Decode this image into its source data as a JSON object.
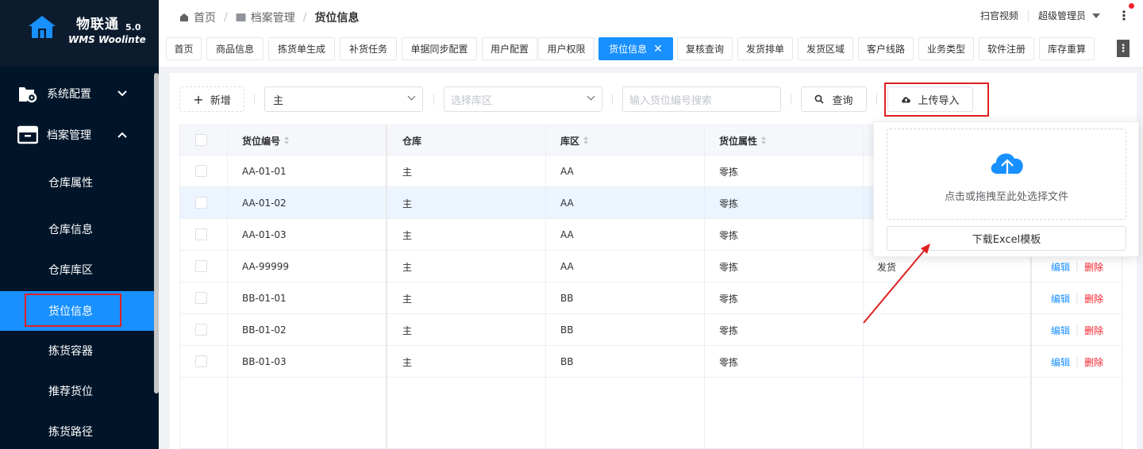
{
  "app": {
    "brand": "物联通",
    "version": "5.0",
    "subtitle": "WMS Woolinte"
  },
  "sidebar": {
    "groups": [
      {
        "label": "系统配置",
        "icon": "folder-gear-icon",
        "expanded": false
      },
      {
        "label": "档案管理",
        "icon": "archive-box-icon",
        "expanded": true
      }
    ],
    "items": [
      {
        "label": "仓库属性",
        "active": false
      },
      {
        "label": "仓库信息",
        "active": false
      },
      {
        "label": "仓库库区",
        "active": false
      },
      {
        "label": "货位信息",
        "active": true
      },
      {
        "label": "拣货容器",
        "active": false
      },
      {
        "label": "推荐货位",
        "active": false
      },
      {
        "label": "拣货路径",
        "active": false
      }
    ]
  },
  "header": {
    "breadcrumb": [
      "首页",
      "档案管理",
      "货位信息"
    ],
    "scan_video": "扫官视频",
    "user": "超级管理员"
  },
  "tabs": [
    {
      "label": "首页"
    },
    {
      "label": "商品信息"
    },
    {
      "label": "拣货单生成"
    },
    {
      "label": "补货任务"
    },
    {
      "label": "单据同步配置"
    },
    {
      "label": "用户配置"
    },
    {
      "label": "用户权限"
    },
    {
      "label": "货位信息",
      "active": true
    },
    {
      "label": "复核查询"
    },
    {
      "label": "发货排单"
    },
    {
      "label": "发货区域"
    },
    {
      "label": "客户线路"
    },
    {
      "label": "业务类型"
    },
    {
      "label": "软件注册"
    },
    {
      "label": "库存重算"
    }
  ],
  "toolbar": {
    "add_label": "新增",
    "warehouse_value": "主",
    "zone_placeholder": "选择库区",
    "search_placeholder": "输入货位编号搜索",
    "query_label": "查询",
    "upload_label": "上传导入"
  },
  "table": {
    "columns": [
      "货位编号",
      "仓库",
      "库区",
      "货位属性"
    ],
    "rows": [
      {
        "code": "AA-01-01",
        "warehouse": "主",
        "zone": "AA",
        "attr": "零拣",
        "extra": ""
      },
      {
        "code": "AA-01-02",
        "warehouse": "主",
        "zone": "AA",
        "attr": "零拣",
        "extra": ""
      },
      {
        "code": "AA-01-03",
        "warehouse": "主",
        "zone": "AA",
        "attr": "零拣",
        "extra": ""
      },
      {
        "code": "AA-99999",
        "warehouse": "主",
        "zone": "AA",
        "attr": "零拣",
        "extra": "发货"
      },
      {
        "code": "BB-01-01",
        "warehouse": "主",
        "zone": "BB",
        "attr": "零拣",
        "extra": ""
      },
      {
        "code": "BB-01-02",
        "warehouse": "主",
        "zone": "BB",
        "attr": "零拣",
        "extra": ""
      },
      {
        "code": "BB-01-03",
        "warehouse": "主",
        "zone": "BB",
        "attr": "零拣",
        "extra": ""
      }
    ],
    "edit_label": "编辑",
    "delete_label": "删除"
  },
  "upload_popover": {
    "drop_text": "点击或拖拽至此处选择文件",
    "download_label": "下载Excel模板"
  },
  "colors": {
    "sidebar_bg": "#001529",
    "accent": "#1890ff",
    "annotation": "#e02020"
  }
}
